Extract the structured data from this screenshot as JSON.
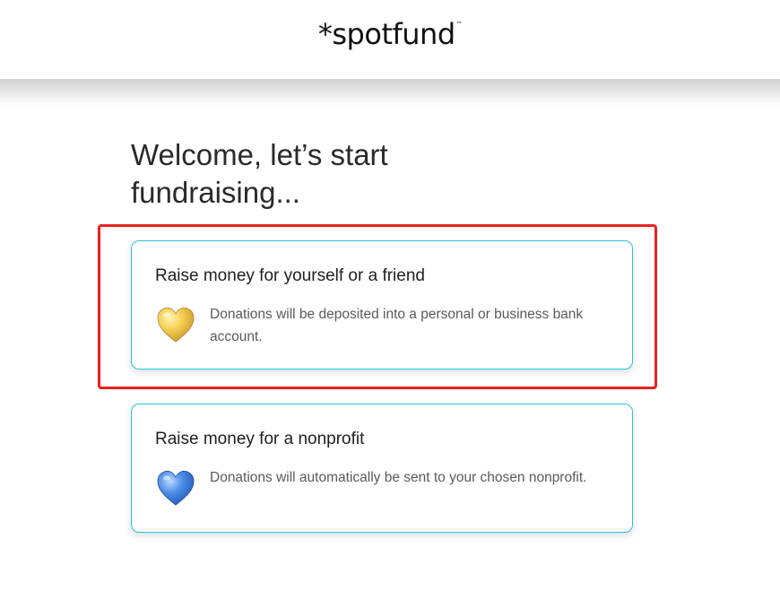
{
  "header": {
    "logo_text": "*spotfund",
    "trademark": "™"
  },
  "main": {
    "title": "Welcome, let’s start fundraising..."
  },
  "options": [
    {
      "title": "Raise money for yourself or a friend",
      "description": "Donations will be deposited into a personal or business bank account.",
      "icon": "yellow-heart-icon",
      "heart_color": "#f3c73a"
    },
    {
      "title": "Raise money for a nonprofit",
      "description": "Donations will automatically be sent to your chosen nonprofit.",
      "icon": "blue-heart-icon",
      "heart_color": "#3b7de0"
    }
  ],
  "colors": {
    "card_border": "#29c4d8",
    "highlight": "#e8221f"
  }
}
